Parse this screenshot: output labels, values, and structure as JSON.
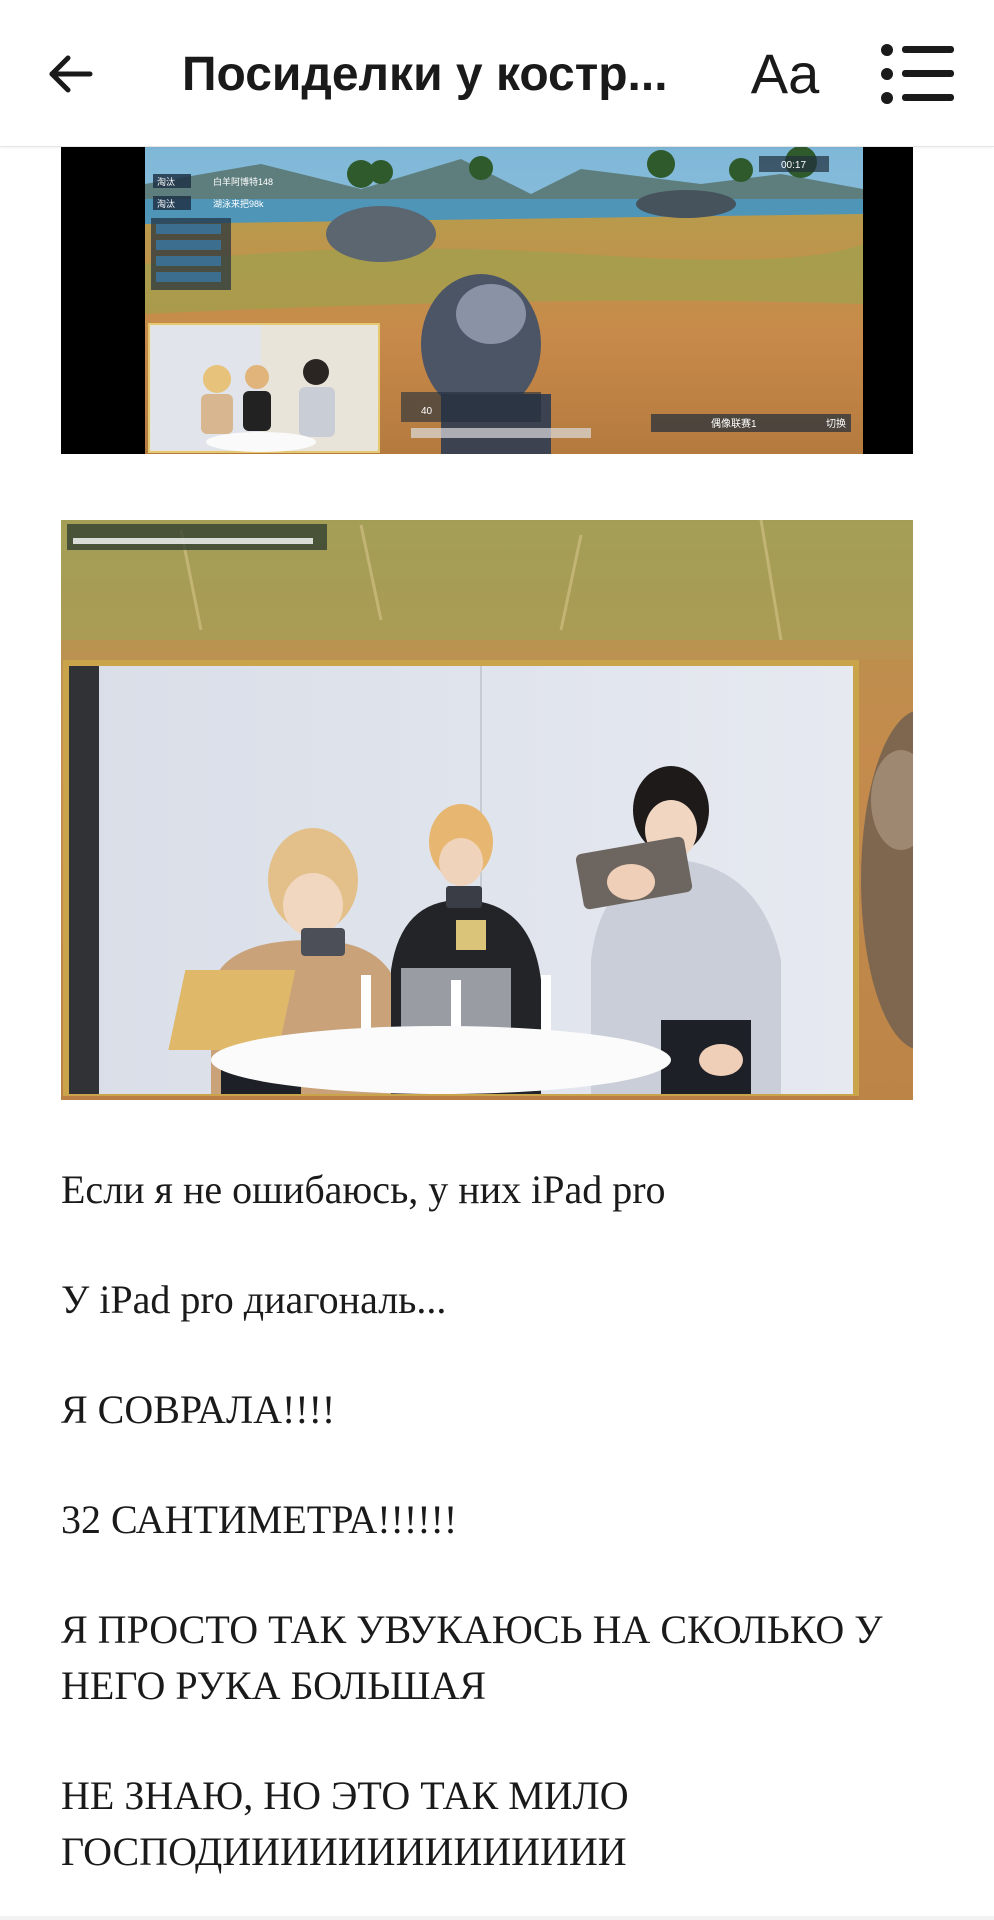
{
  "header": {
    "title": "Посиделки у костр...",
    "font_button_label": "Aa",
    "back_icon": "arrow-left-icon",
    "toc_icon": "list-icon"
  },
  "article": {
    "images": [
      {
        "name": "game-stream-screenshot",
        "hud_labels": [
          "淘汰",
          "白羊阿博特148",
          "淘汰",
          "湖泳来把98k",
          "00:17",
          "40",
          "偶像联赛1",
          "切换"
        ]
      },
      {
        "name": "members-playing-closeup"
      }
    ],
    "paragraphs": [
      "Если я не ошибаюсь, у них iPad pro",
      "У iPad pro диагональ...",
      "Я СОВРАЛА!!!!",
      "32 САНТИМЕТРА!!!!!!",
      "Я ПРОСТО ТАК УВУКАЮСЬ НА СКОЛЬКО У НЕГО РУКА БОЛЬШАЯ",
      "НЕ ЗНАЮ, НО ЭТО ТАК МИЛО ГОСПОДИИИИИИИИИИИИИИ"
    ]
  },
  "colors": {
    "text": "#1a1a1a",
    "background": "#ffffff"
  }
}
